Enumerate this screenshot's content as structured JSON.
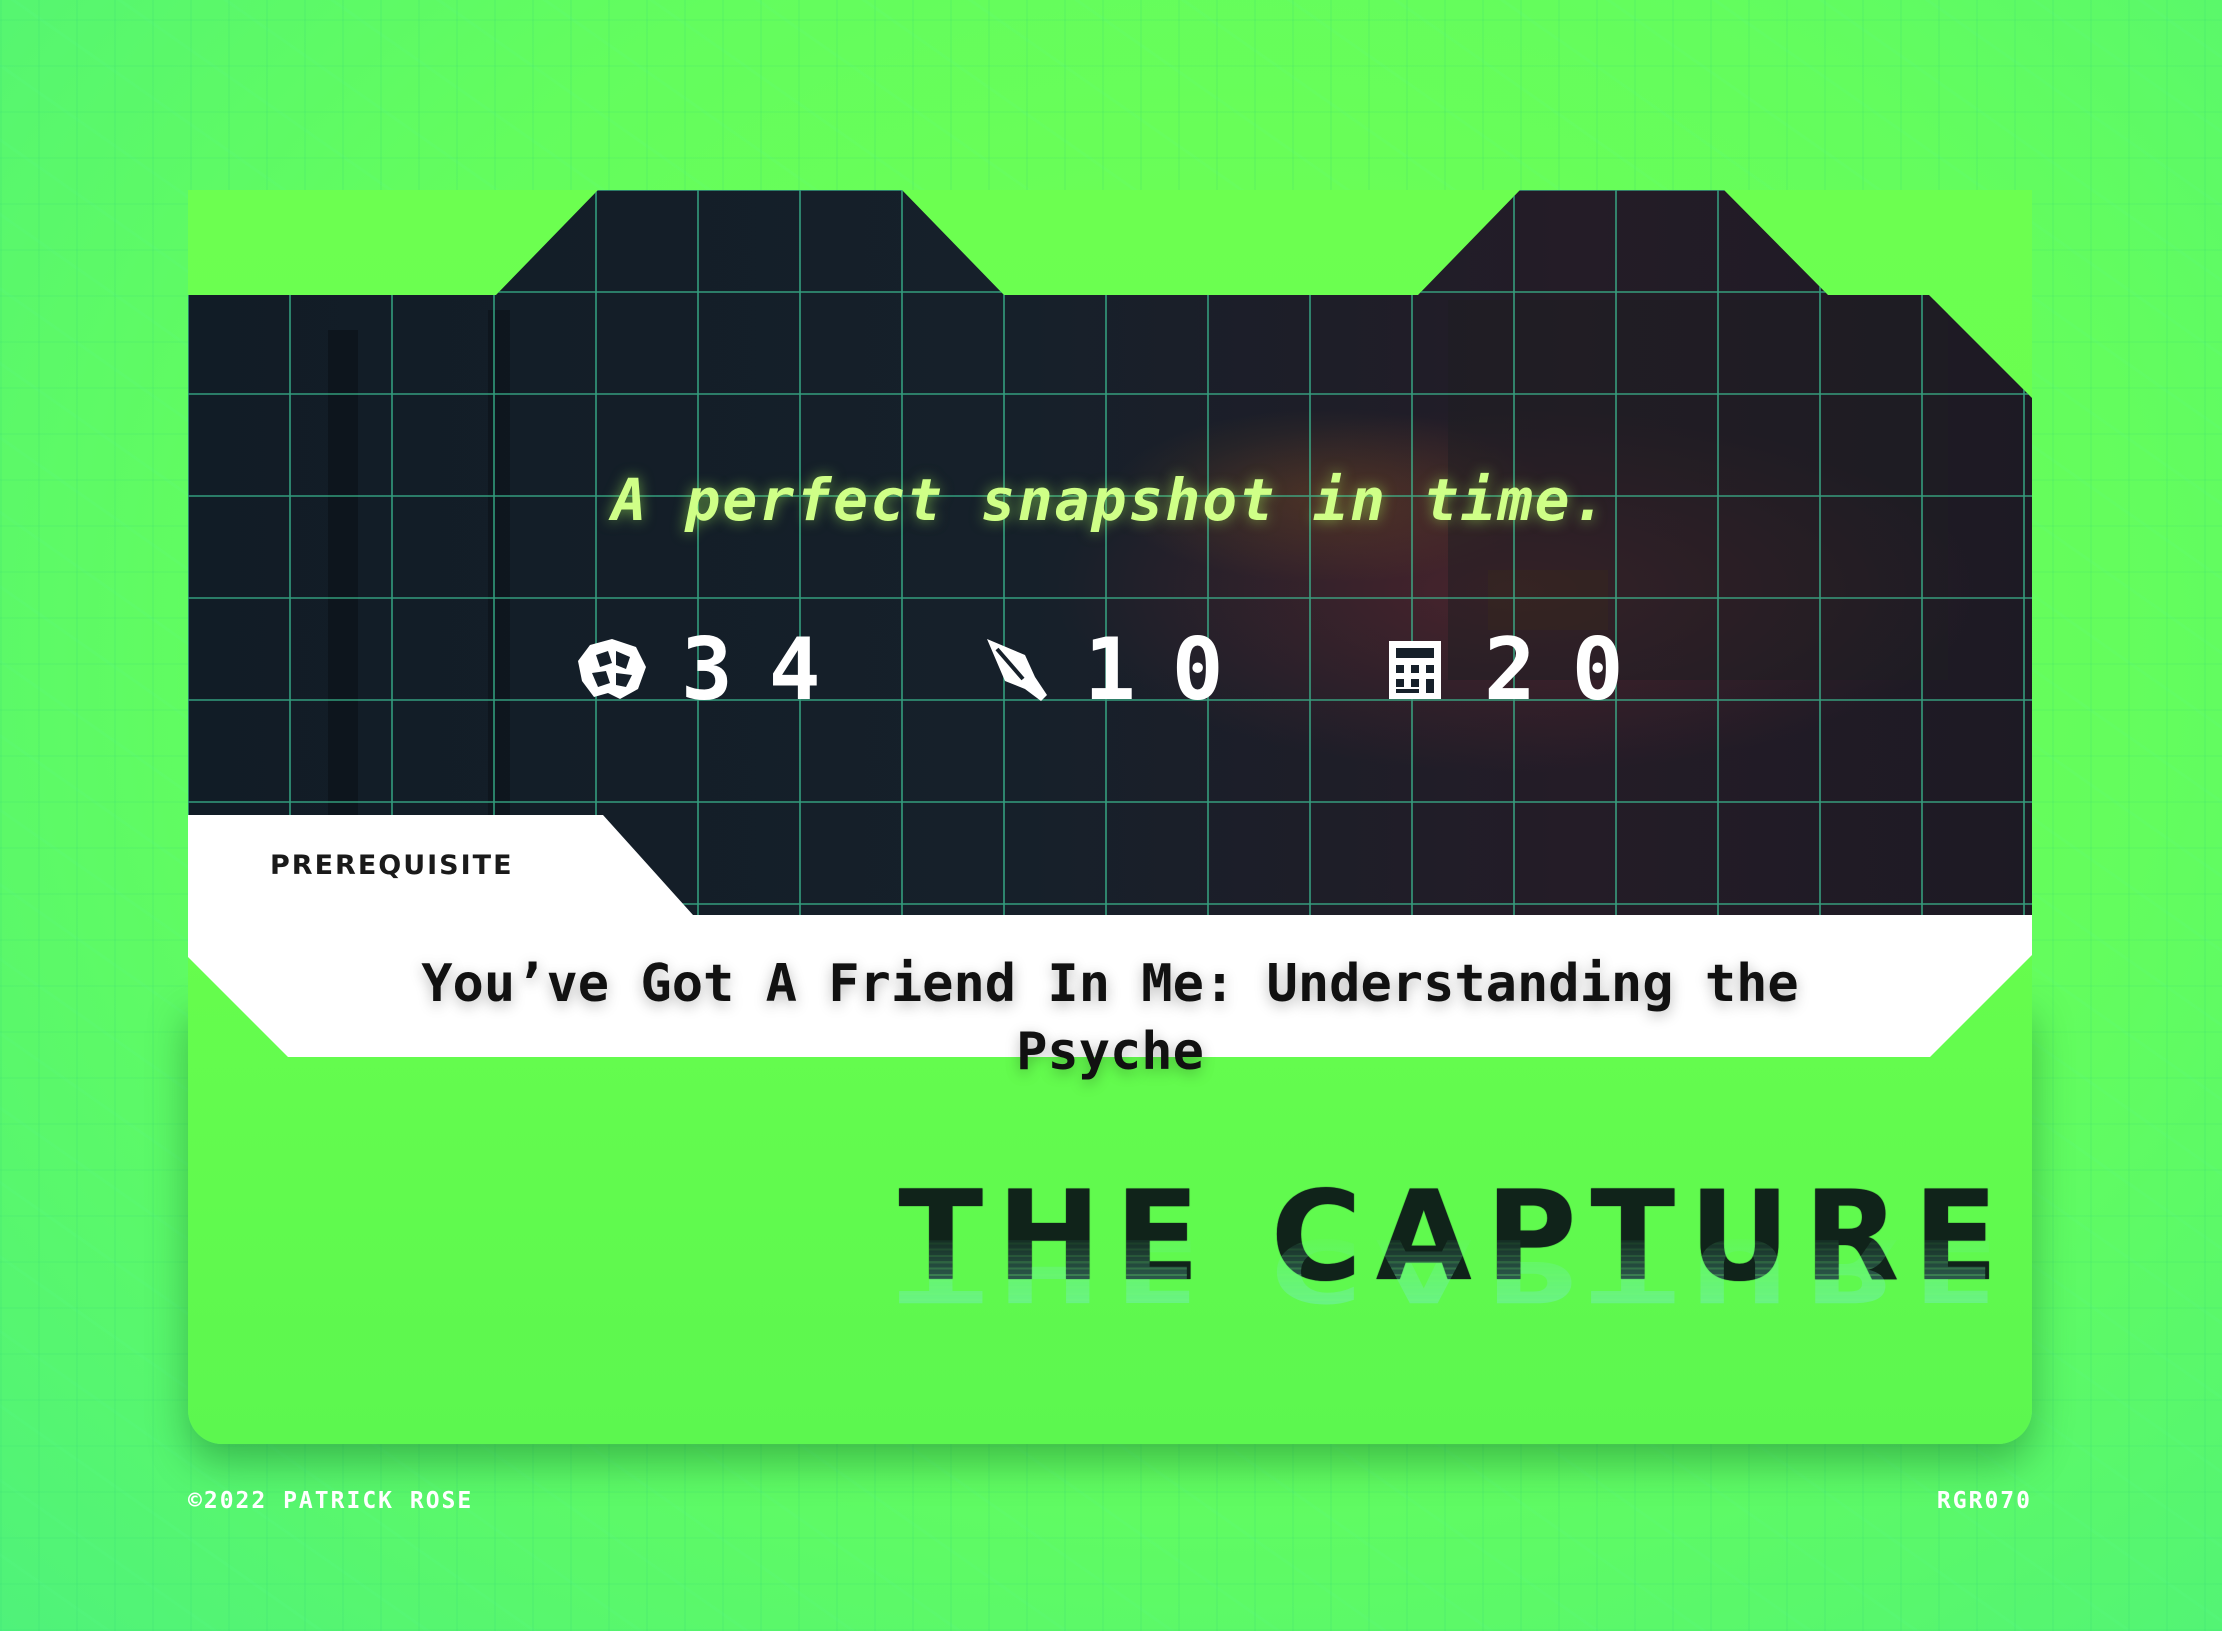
{
  "card": {
    "tagline": "A perfect snapshot in time.",
    "stats": [
      {
        "icon": "brain-icon",
        "value": "34"
      },
      {
        "icon": "quill-pen-icon",
        "value": "10"
      },
      {
        "icon": "calculator-icon",
        "value": "20"
      }
    ],
    "prerequisite_label": "PREREQUISITE",
    "prerequisite_text": "You’ve Got A Friend In Me: Understanding the Psyche",
    "title": "THE CAPTURE"
  },
  "footer": {
    "copyright": "©2022 PATRICK ROSE",
    "code": "RGR070"
  },
  "colors": {
    "background": "#63fd5e",
    "card_bottom": "#66fd4d",
    "art_dark": "#0f1a22",
    "grid_line": "#3fc79a",
    "tagline": "#cfff87",
    "title": "#10231a",
    "white_panel": "#ffffff"
  }
}
